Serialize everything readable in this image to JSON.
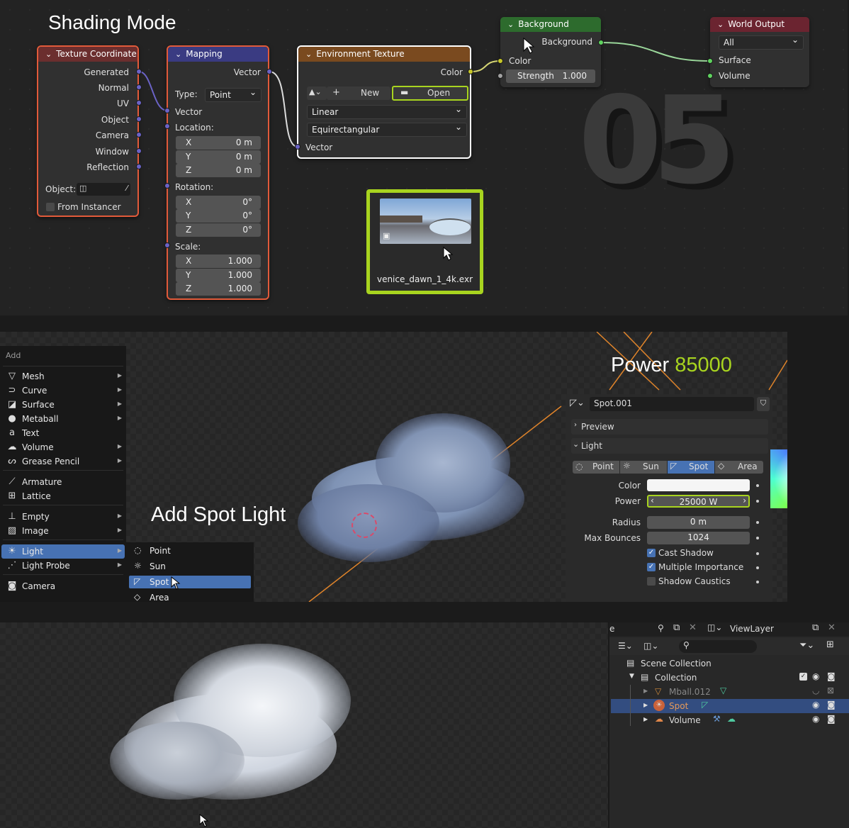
{
  "panel1": {
    "title": "Shading Mode",
    "big_number": "05",
    "texture_coordinate": {
      "header": "Texture Coordinate",
      "outputs": [
        "Generated",
        "Normal",
        "UV",
        "Object",
        "Camera",
        "Window",
        "Reflection"
      ],
      "object_label": "Object:",
      "from_instancer": "From Instancer"
    },
    "mapping": {
      "header": "Mapping",
      "output": "Vector",
      "type_label": "Type:",
      "type_value": "Point",
      "vector_label": "Vector",
      "location_label": "Location:",
      "location": [
        {
          "axis": "X",
          "value": "0 m"
        },
        {
          "axis": "Y",
          "value": "0 m"
        },
        {
          "axis": "Z",
          "value": "0 m"
        }
      ],
      "rotation_label": "Rotation:",
      "rotation": [
        {
          "axis": "X",
          "value": "0°"
        },
        {
          "axis": "Y",
          "value": "0°"
        },
        {
          "axis": "Z",
          "value": "0°"
        }
      ],
      "scale_label": "Scale:",
      "scale": [
        {
          "axis": "X",
          "value": "1.000"
        },
        {
          "axis": "Y",
          "value": "1.000"
        },
        {
          "axis": "Z",
          "value": "1.000"
        }
      ]
    },
    "env_texture": {
      "header": "Environment Texture",
      "output": "Color",
      "new_label": "New",
      "open_label": "Open",
      "interpolation": "Linear",
      "projection": "Equirectangular",
      "vector_label": "Vector"
    },
    "background": {
      "header": "Background",
      "output": "Background",
      "color_label": "Color",
      "strength_label": "Strength",
      "strength_value": "1.000"
    },
    "world_output": {
      "header": "World Output",
      "target": "All",
      "surface": "Surface",
      "volume": "Volume"
    },
    "file_card": {
      "filename": "venice_dawn_1_4k.exr"
    }
  },
  "panel2": {
    "add_menu": {
      "title": "Add",
      "items": [
        {
          "label": "Mesh",
          "icon": "mesh-icon",
          "glyph": "▽",
          "submenu": true
        },
        {
          "label": "Curve",
          "icon": "curve-icon",
          "glyph": "⊃",
          "submenu": true
        },
        {
          "label": "Surface",
          "icon": "surface-icon",
          "glyph": "◪",
          "submenu": true
        },
        {
          "label": "Metaball",
          "icon": "metaball-icon",
          "glyph": "●",
          "submenu": true
        },
        {
          "label": "Text",
          "icon": "text-icon",
          "glyph": "a",
          "submenu": false
        },
        {
          "label": "Volume",
          "icon": "volume-icon",
          "glyph": "☁",
          "submenu": true
        },
        {
          "label": "Grease Pencil",
          "icon": "grease-pencil-icon",
          "glyph": "ᔕ",
          "submenu": true
        },
        {
          "label": "Armature",
          "icon": "armature-icon",
          "glyph": "⟋",
          "submenu": false
        },
        {
          "label": "Lattice",
          "icon": "lattice-icon",
          "glyph": "⊞",
          "submenu": false
        },
        {
          "label": "Empty",
          "icon": "empty-icon",
          "glyph": "⊥",
          "submenu": true
        },
        {
          "label": "Image",
          "icon": "image-icon",
          "glyph": "▨",
          "submenu": true
        },
        {
          "label": "Light",
          "icon": "light-icon",
          "glyph": "☀",
          "submenu": true
        },
        {
          "label": "Light Probe",
          "icon": "light-probe-icon",
          "glyph": "⋰",
          "submenu": true
        },
        {
          "label": "Camera",
          "icon": "camera-icon",
          "glyph": "◙",
          "submenu": false
        }
      ],
      "light_submenu": [
        {
          "label": "Point",
          "icon": "point-light-icon",
          "glyph": "◌"
        },
        {
          "label": "Sun",
          "icon": "sun-light-icon",
          "glyph": "☼"
        },
        {
          "label": "Spot",
          "icon": "spot-light-icon",
          "glyph": "◸"
        },
        {
          "label": "Area",
          "icon": "area-light-icon",
          "glyph": "◇"
        }
      ]
    },
    "overlay_text": "Add Spot Light",
    "power_label": "Power",
    "power_value": "85000",
    "properties": {
      "object_name": "Spot.001",
      "preview": "Preview",
      "light": "Light",
      "types": [
        "Point",
        "Sun",
        "Spot",
        "Area"
      ],
      "active_type": "Spot",
      "color_label": "Color",
      "power_label": "Power",
      "power_value": "25000 W",
      "radius_label": "Radius",
      "radius_value": "0 m",
      "max_bounces_label": "Max Bounces",
      "max_bounces_value": "1024",
      "cast_shadow": "Cast Shadow",
      "multiple_importance": "Multiple Importance",
      "shadow_caustics": "Shadow Caustics"
    }
  },
  "panel3": {
    "outliner": {
      "tab_label": "e",
      "view_layer": "ViewLayer",
      "scene_collection": "Scene Collection",
      "collection": "Collection",
      "items": [
        {
          "label": "Mball.012",
          "selected": false
        },
        {
          "label": "Spot",
          "selected": true
        },
        {
          "label": "Volume",
          "selected": false
        }
      ]
    }
  },
  "colors": {
    "accent_green": "#a8d41f",
    "blender_blue": "#4772b3",
    "node_red_border": "#e25a3a",
    "mapping_header": "#3a3b82",
    "texture_header": "#6b2e2e",
    "env_header": "#7a4a1f",
    "background_header": "#2d6b2d",
    "output_header": "#6b2430"
  }
}
